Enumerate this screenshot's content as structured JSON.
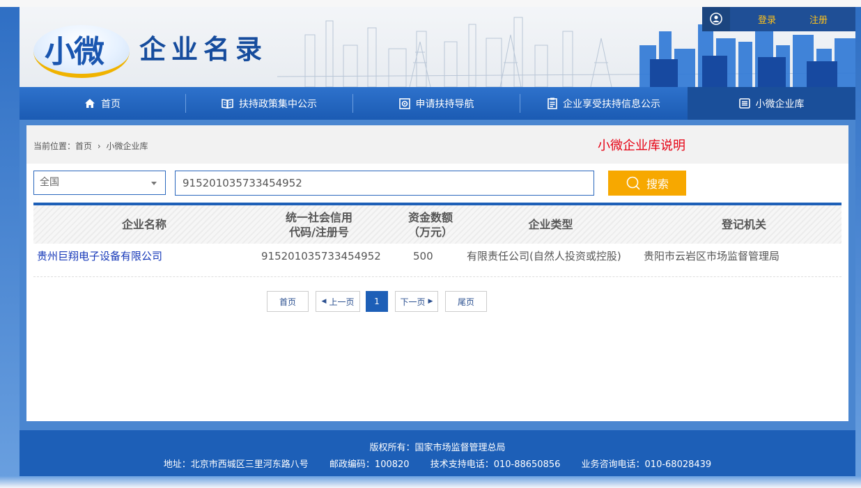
{
  "header": {
    "logo_mark": "小微",
    "logo_title": "企业名录",
    "auth": {
      "login": "登录",
      "register": "注册"
    }
  },
  "nav": {
    "items": [
      {
        "label": "首页",
        "icon": "home-icon"
      },
      {
        "label": "扶持政策集中公示",
        "icon": "book-icon"
      },
      {
        "label": "申请扶持导航",
        "icon": "navigation-icon"
      },
      {
        "label": "企业享受扶持信息公示",
        "icon": "clipboard-icon"
      },
      {
        "label": "小微企业库",
        "icon": "list-icon"
      }
    ],
    "active_index": 4
  },
  "breadcrumb": {
    "prefix": "当前位置：",
    "home": "首页",
    "current": "小微企业库"
  },
  "explain_link": "小微企业库说明",
  "search": {
    "region": "全国",
    "query": "915201035733454952",
    "button_label": "搜索"
  },
  "table": {
    "headers": [
      "企业名称",
      "统一社会信用代码/注册号",
      "资金数额（万元）",
      "企业类型",
      "登记机关"
    ],
    "header_lines": {
      "credit_line1": "统一社会信用",
      "credit_line2": "代码/注册号",
      "capital_line1": "资金数额",
      "capital_line2": "（万元）"
    },
    "rows": [
      {
        "name": "贵州巨翔电子设备有限公司",
        "credit_code": "915201035733454952",
        "capital": "500",
        "type": "有限责任公司(自然人投资或控股)",
        "authority": "贵阳市云岩区市场监督管理局"
      }
    ]
  },
  "pagination": {
    "first": "首页",
    "prev": "上一页",
    "current": "1",
    "next": "下一页",
    "last": "尾页"
  },
  "footer": {
    "copyright": "版权所有：国家市场监督管理总局",
    "address": "地址：北京市西城区三里河东路八号",
    "postcode": "邮政编码：100820",
    "tech_phone": "技术支持电话：010-88650856",
    "biz_phone": "业务咨询电话：010-68028439"
  },
  "colors": {
    "brand_blue": "#1d5fb7",
    "search_button": "#f7a800",
    "explain_link": "#e60012",
    "company_link": "#1537b8",
    "auth_text": "#ffc21a"
  }
}
